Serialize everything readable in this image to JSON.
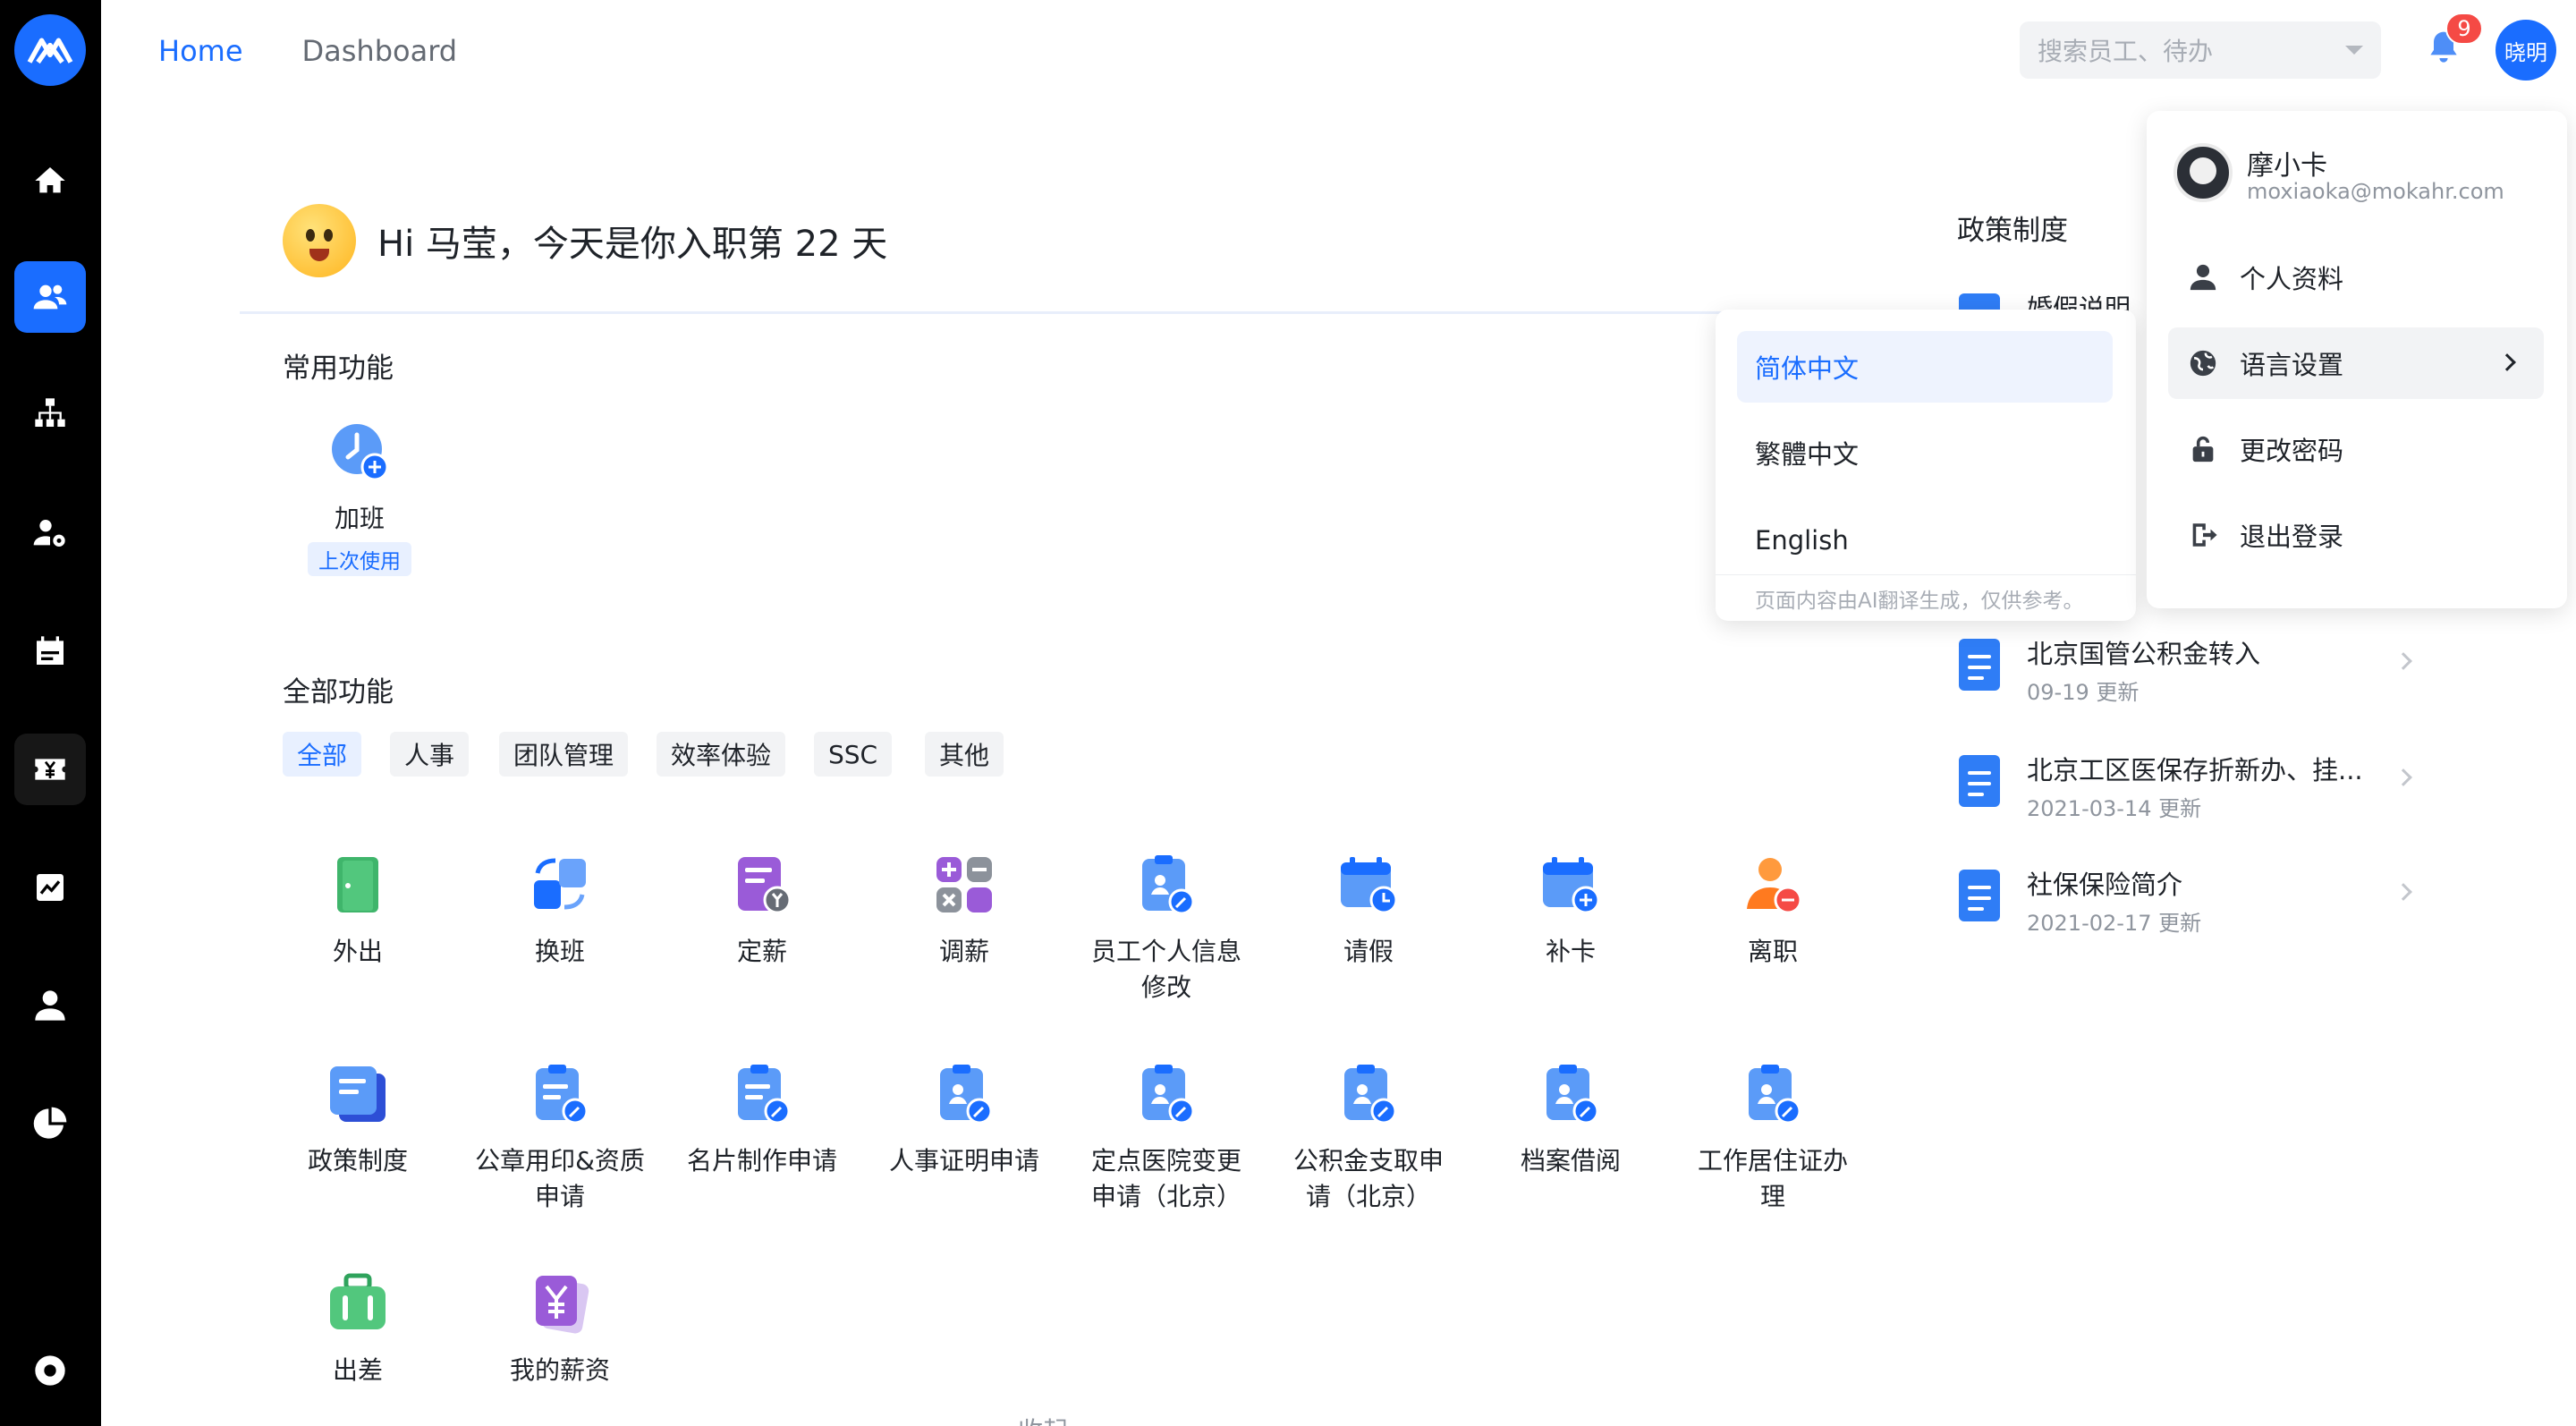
{
  "topnav": {
    "home": "Home",
    "dashboard": "Dashboard"
  },
  "search": {
    "placeholder": "搜索员工、待办"
  },
  "notifications": {
    "count": "9"
  },
  "user": {
    "avatar_text": "晓明",
    "name": "摩小卡",
    "email": "moxiaoka@mokahr.com"
  },
  "greeting": {
    "text": "Hi 马莹，今天是你入职第 22 天"
  },
  "common": {
    "title": "常用功能",
    "items": [
      {
        "label": "加班",
        "tag": "上次使用"
      }
    ]
  },
  "all": {
    "title": "全部功能",
    "categories": [
      "全部",
      "人事",
      "团队管理",
      "效率体验",
      "SSC",
      "其他"
    ],
    "row1": [
      "外出",
      "换班",
      "定薪",
      "调薪",
      "员工个人信息修改",
      "请假",
      "补卡",
      "离职"
    ],
    "row2": [
      "政策制度",
      "公章用印&资质申请",
      "名片制作申请",
      "人事证明申请",
      "定点医院变更申请（北京）",
      "公积金支取申请（北京）",
      "档案借阅",
      "工作居住证办理"
    ],
    "row3": [
      "出差",
      "我的薪资"
    ],
    "collapse": "收起"
  },
  "policy": {
    "title": "政策制度",
    "partial_title": "婚假说明",
    "docs": [
      {
        "title": "北京国管公积金转入",
        "date": "09-19 更新"
      },
      {
        "title": "北京工区医保存折新办、挂...",
        "date": "2021-03-14 更新"
      },
      {
        "title": "社保保险简介",
        "date": "2021-02-17 更新"
      }
    ]
  },
  "language": {
    "options": [
      "简体中文",
      "繁體中文",
      "English"
    ],
    "selected": "简体中文",
    "note": "页面内容由AI翻译生成，仅供参考。"
  },
  "user_menu": {
    "profile": "个人资料",
    "language": "语言设置",
    "password": "更改密码",
    "logout": "退出登录"
  },
  "colors": {
    "accent": "#1a6dff",
    "rail": "#000000",
    "badge": "#f54a45"
  }
}
